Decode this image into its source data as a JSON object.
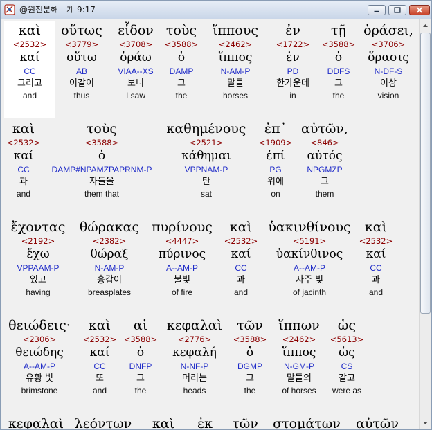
{
  "window": {
    "title": "@원전분해 - 계 9:17",
    "icon": "scripture-icon"
  },
  "lines": [
    [
      {
        "greek": "καὶ",
        "strong": "<2532>",
        "lemma": "καί",
        "parse": "CC",
        "korean": "그리고",
        "english": "and"
      },
      {
        "greek": "οὕτως",
        "strong": "<3779>",
        "lemma": "οὕτω",
        "parse": "AB",
        "korean": "이같이",
        "english": "thus"
      },
      {
        "greek": "εἶδον",
        "strong": "<3708>",
        "lemma": "ὁράω",
        "parse": "VIAA--XS",
        "korean": "보니",
        "english": "I saw"
      },
      {
        "greek": "τοὺς",
        "strong": "<3588>",
        "lemma": "ὁ",
        "parse": "DAMP",
        "korean": "그",
        "english": "the"
      },
      {
        "greek": "ἵππους",
        "strong": "<2462>",
        "lemma": "ἵππος",
        "parse": "N-AM-P",
        "korean": "말들",
        "english": "horses"
      },
      {
        "greek": "ἐν",
        "strong": "<1722>",
        "lemma": "ἐν",
        "parse": "PD",
        "korean": "한가운데",
        "english": "in"
      },
      {
        "greek": "τῇ",
        "strong": "<3588>",
        "lemma": "ὁ",
        "parse": "DDFS",
        "korean": "그",
        "english": "the"
      },
      {
        "greek": "ὁράσει,",
        "strong": "<3706>",
        "lemma": "ὅρασις",
        "parse": "N-DF-S",
        "korean": "이상",
        "english": "vision"
      }
    ],
    [
      {
        "greek": "καὶ",
        "strong": "<2532>",
        "lemma": "καί",
        "parse": "CC",
        "korean": "과",
        "english": "and"
      },
      {
        "greek": "τοὺς",
        "strong": "<3588>",
        "lemma": "ὁ",
        "parse": "DAMP#NPAMZPAPRNM-P",
        "korean": "자들을",
        "english": "them that"
      },
      {
        "greek": "καθημένους",
        "strong": "<2521>",
        "lemma": "κάθημαι",
        "parse": "VPPNAM-P",
        "korean": "탄",
        "english": "sat"
      },
      {
        "greek": "ἐπ᾽",
        "strong": "<1909>",
        "lemma": "ἐπί",
        "parse": "PG",
        "korean": "위에",
        "english": "on"
      },
      {
        "greek": "αὐτῶν,",
        "strong": "<846>",
        "lemma": "αὐτός",
        "parse": "NPGMZP",
        "korean": "그",
        "english": "them"
      }
    ],
    [
      {
        "greek": "ἔχοντας",
        "strong": "<2192>",
        "lemma": "ἔχω",
        "parse": "VPPAAM-P",
        "korean": "있고",
        "english": "having"
      },
      {
        "greek": "θώρακας",
        "strong": "<2382>",
        "lemma": "θώραξ",
        "parse": "N-AM-P",
        "korean": "흉갑이",
        "english": "breasplates"
      },
      {
        "greek": "πυρίνους",
        "strong": "<4447>",
        "lemma": "πύρινος",
        "parse": "A--AM-P",
        "korean": "불빛",
        "english": "of fire"
      },
      {
        "greek": "καὶ",
        "strong": "<2532>",
        "lemma": "καί",
        "parse": "CC",
        "korean": "과",
        "english": "and"
      },
      {
        "greek": "ὑακινθίνους",
        "strong": "<5191>",
        "lemma": "ὑακίνθινος",
        "parse": "A--AM-P",
        "korean": "자주 빛",
        "english": "of jacinth"
      },
      {
        "greek": "καὶ",
        "strong": "<2532>",
        "lemma": "καί",
        "parse": "CC",
        "korean": "과",
        "english": "and"
      }
    ],
    [
      {
        "greek": "θειώδεις·",
        "strong": "<2306>",
        "lemma": "θειώδης",
        "parse": "A--AM-P",
        "korean": "유황 빛",
        "english": "brimstone"
      },
      {
        "greek": "καὶ",
        "strong": "<2532>",
        "lemma": "καί",
        "parse": "CC",
        "korean": "또",
        "english": "and"
      },
      {
        "greek": "αἱ",
        "strong": "<3588>",
        "lemma": "ὁ",
        "parse": "DNFP",
        "korean": "그",
        "english": "the"
      },
      {
        "greek": "κεφαλαὶ",
        "strong": "<2776>",
        "lemma": "κεφαλή",
        "parse": "N-NF-P",
        "korean": "머리는",
        "english": "heads"
      },
      {
        "greek": "τῶν",
        "strong": "<3588>",
        "lemma": "ὁ",
        "parse": "DGMP",
        "korean": "그",
        "english": "the"
      },
      {
        "greek": "ἵππων",
        "strong": "<2462>",
        "lemma": "ἵππος",
        "parse": "N-GM-P",
        "korean": "말들의",
        "english": "of horses"
      },
      {
        "greek": "ὡς",
        "strong": "<5613>",
        "lemma": "ὡς",
        "parse": "CS",
        "korean": "같고",
        "english": "were as"
      }
    ],
    [
      {
        "greek": "κεφαλαὶ"
      },
      {
        "greek": "λεόντων"
      },
      {
        "greek": "καὶ"
      },
      {
        "greek": "ἐκ"
      },
      {
        "greek": "τῶν"
      },
      {
        "greek": "στομάτων"
      },
      {
        "greek": "αὐτῶν"
      }
    ]
  ]
}
